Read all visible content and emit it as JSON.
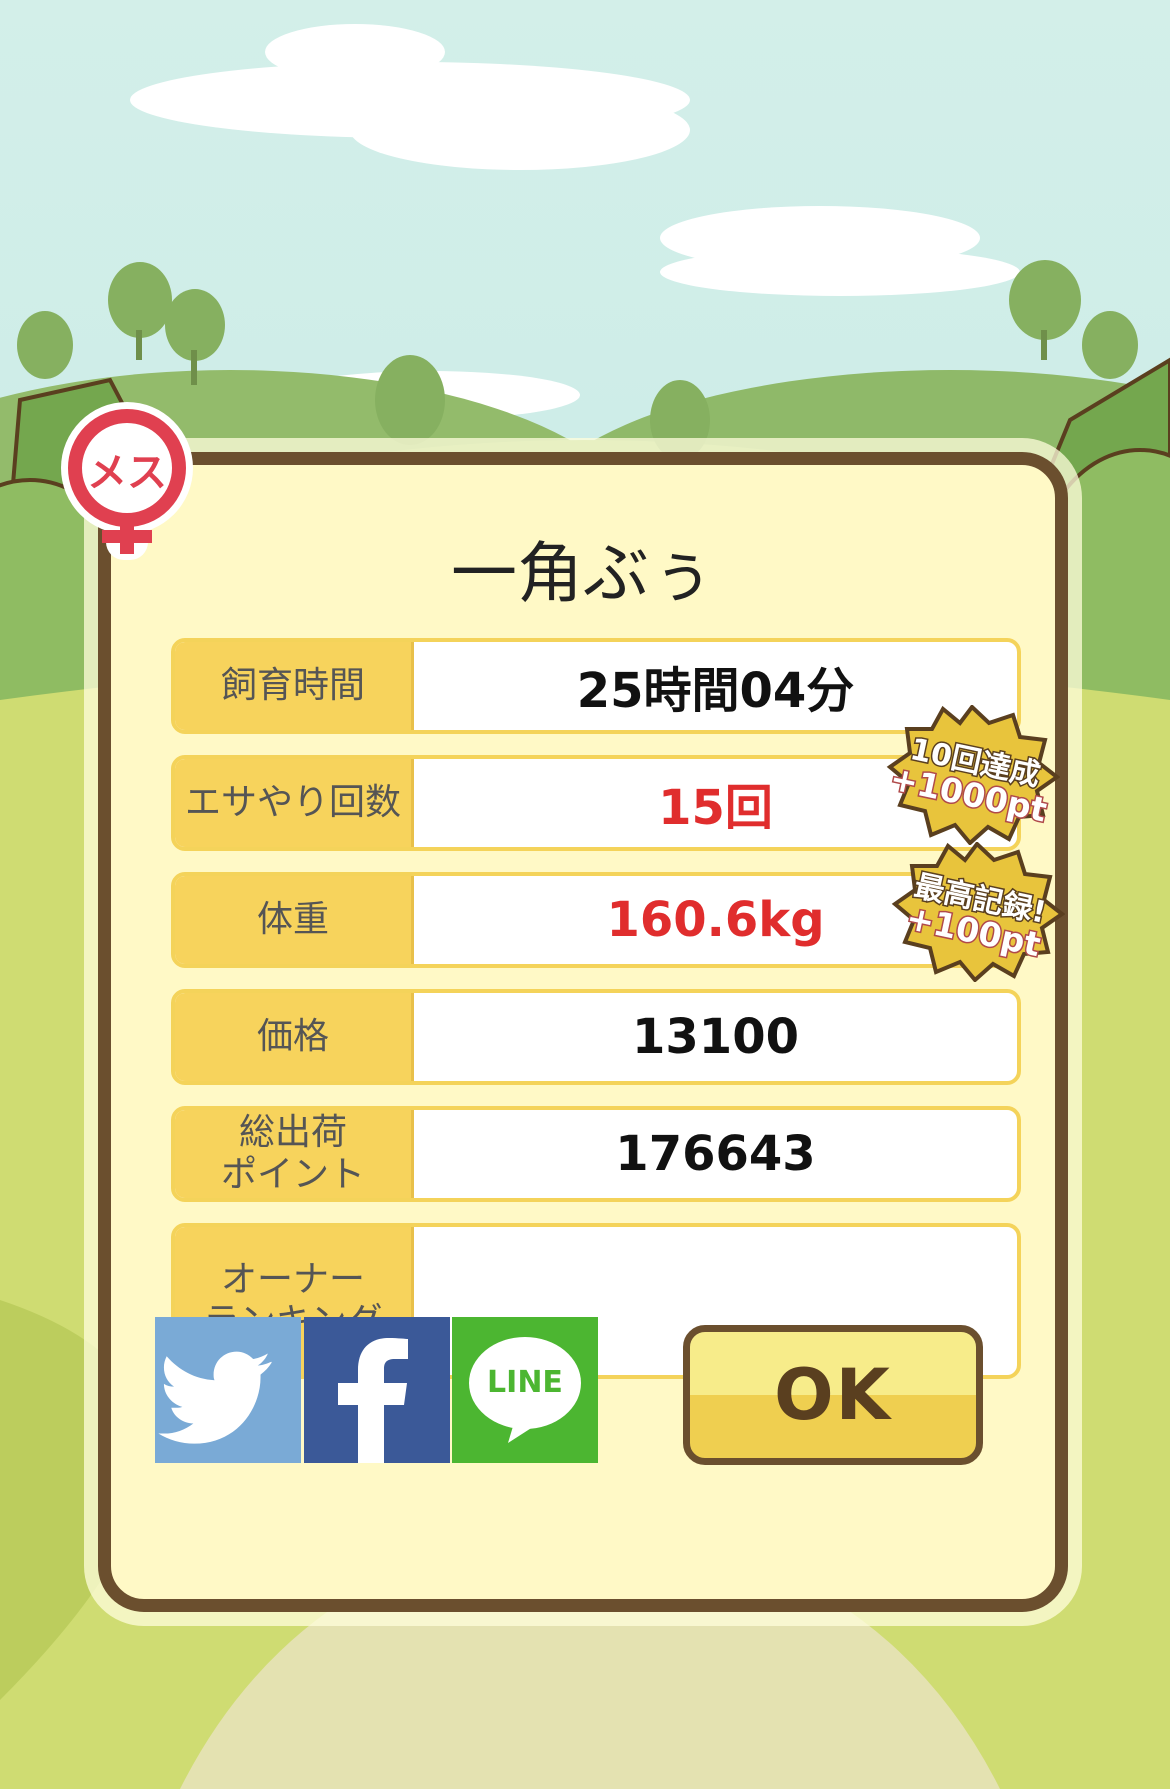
{
  "pig": {
    "name": "一角ぶぅ"
  },
  "gender": {
    "label": "メス",
    "icon": "female-icon",
    "color": "#e04050"
  },
  "stats": [
    {
      "label": "飼育時間",
      "value": "25時間04分",
      "highlight": false
    },
    {
      "label": "エサやり回数",
      "value": "15回",
      "highlight": true
    },
    {
      "label": "体重",
      "value": "160.6kg",
      "highlight": true
    },
    {
      "label": "価格",
      "value": "13100",
      "highlight": false
    },
    {
      "label": "総出荷\nポイント",
      "value": "176643",
      "highlight": false
    },
    {
      "label": "オーナー\nランキング",
      "value": "",
      "highlight": false
    }
  ],
  "badges": [
    {
      "line1": "10回達成",
      "line2": "+1000pt"
    },
    {
      "line1": "最高記録!",
      "line2": "+100pt"
    }
  ],
  "share": {
    "twitter": {
      "icon": "twitter-bird-icon",
      "color": "#7aaad6"
    },
    "facebook": {
      "label": "f",
      "icon": "facebook-icon",
      "color": "#3b5998"
    },
    "line": {
      "label": "LINE",
      "icon": "line-icon",
      "color": "#4cb631"
    }
  },
  "ok_label": "OK",
  "colors": {
    "label_bg": "#f7d35c",
    "panel_bg": "#fff9c6",
    "border": "#6b4f2e",
    "highlight": "#e02d2d"
  }
}
